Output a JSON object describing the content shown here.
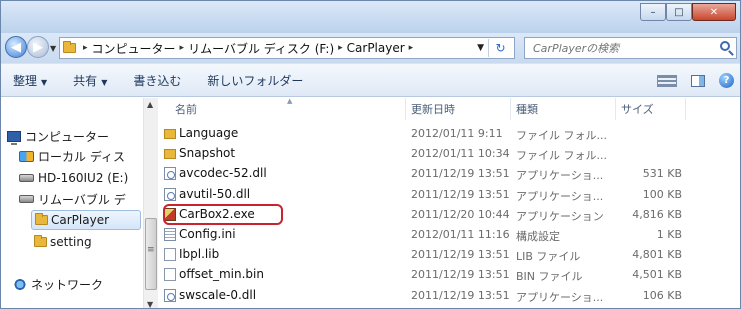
{
  "window": {
    "caption_min": "–",
    "caption_max": "□",
    "caption_close": "✕"
  },
  "address": {
    "crumbs": [
      "コンピューター",
      "リムーバブル ディスク (F:)",
      "CarPlayer"
    ],
    "search_placeholder": "CarPlayerの検索"
  },
  "toolbar": {
    "organize": "整理",
    "share": "共有",
    "burn": "書き込む",
    "new_folder": "新しいフォルダー"
  },
  "nav": {
    "computer": "コンピューター",
    "local_disk": "ローカル ディス",
    "hd": "HD-160IU2 (E:)",
    "removable": "リムーバブル デ",
    "carplayer": "CarPlayer",
    "setting": "setting",
    "network": "ネットワーク"
  },
  "columns": {
    "name": "名前",
    "date": "更新日時",
    "type": "種類",
    "size": "サイズ"
  },
  "files": [
    {
      "name": "Language",
      "date": "2012/01/11 9:11",
      "type": "ファイル フォル...",
      "size": "",
      "icon": "folder"
    },
    {
      "name": "Snapshot",
      "date": "2012/01/11 10:34",
      "type": "ファイル フォル...",
      "size": "",
      "icon": "folder"
    },
    {
      "name": "avcodec-52.dll",
      "date": "2011/12/19 13:51",
      "type": "アプリケーショ...",
      "size": "531 KB",
      "icon": "dll"
    },
    {
      "name": "avutil-50.dll",
      "date": "2011/12/19 13:51",
      "type": "アプリケーショ...",
      "size": "100 KB",
      "icon": "dll"
    },
    {
      "name": "CarBox2.exe",
      "date": "2011/12/20 10:44",
      "type": "アプリケーション",
      "size": "4,816 KB",
      "icon": "exe"
    },
    {
      "name": "Config.ini",
      "date": "2012/01/11 11:16",
      "type": "構成設定",
      "size": "1 KB",
      "icon": "ini"
    },
    {
      "name": "Ibpl.lib",
      "date": "2011/12/19 13:51",
      "type": "LIB ファイル",
      "size": "4,801 KB",
      "icon": "file"
    },
    {
      "name": "offset_min.bin",
      "date": "2011/12/19 13:51",
      "type": "BIN ファイル",
      "size": "4,501 KB",
      "icon": "file"
    },
    {
      "name": "swscale-0.dll",
      "date": "2011/12/19 13:51",
      "type": "アプリケーショ...",
      "size": "106 KB",
      "icon": "dll"
    }
  ],
  "highlight_file": "CarBox2.exe",
  "colors": {
    "highlight_border": "#c8232f",
    "selected_bg": "#d5e6f9"
  }
}
